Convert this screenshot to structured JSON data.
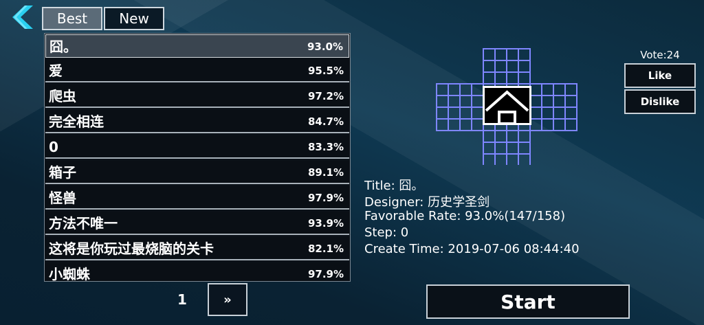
{
  "tabs": {
    "best": "Best",
    "new": "New",
    "active": "best"
  },
  "levels": [
    {
      "title": "囧。",
      "rate": "93.0%"
    },
    {
      "title": "爱",
      "rate": "95.5%"
    },
    {
      "title": "爬虫",
      "rate": "97.2%"
    },
    {
      "title": "完全相连",
      "rate": "84.7%"
    },
    {
      "title": "0",
      "rate": "83.3%"
    },
    {
      "title": "箱子",
      "rate": "89.1%"
    },
    {
      "title": "怪兽",
      "rate": "97.9%"
    },
    {
      "title": "方法不唯一",
      "rate": "93.9%"
    },
    {
      "title": "这将是你玩过最烧脑的关卡",
      "rate": "82.1%"
    },
    {
      "title": "小蜘蛛",
      "rate": "97.9%"
    }
  ],
  "pagination": {
    "page": "1",
    "next_label": "»"
  },
  "vote": {
    "label": "Vote:24",
    "like_label": "Like",
    "dislike_label": "Dislike"
  },
  "info": {
    "title": "Title: 囧。",
    "designer": "Designer: 历史学圣剑",
    "favorable_rate": "Favorable Rate: 93.0%(147/158)",
    "step": "Step: 0",
    "create_time": "Create Time: 2019-07-06 08:44:40"
  },
  "start_label": "Start",
  "colors": {
    "grid": "#7f86ff",
    "accent": "#2ad0f0",
    "selected_row": "#3a4550"
  },
  "icons": {
    "back": "back-chevron-icon",
    "preview_house": "house-icon"
  }
}
